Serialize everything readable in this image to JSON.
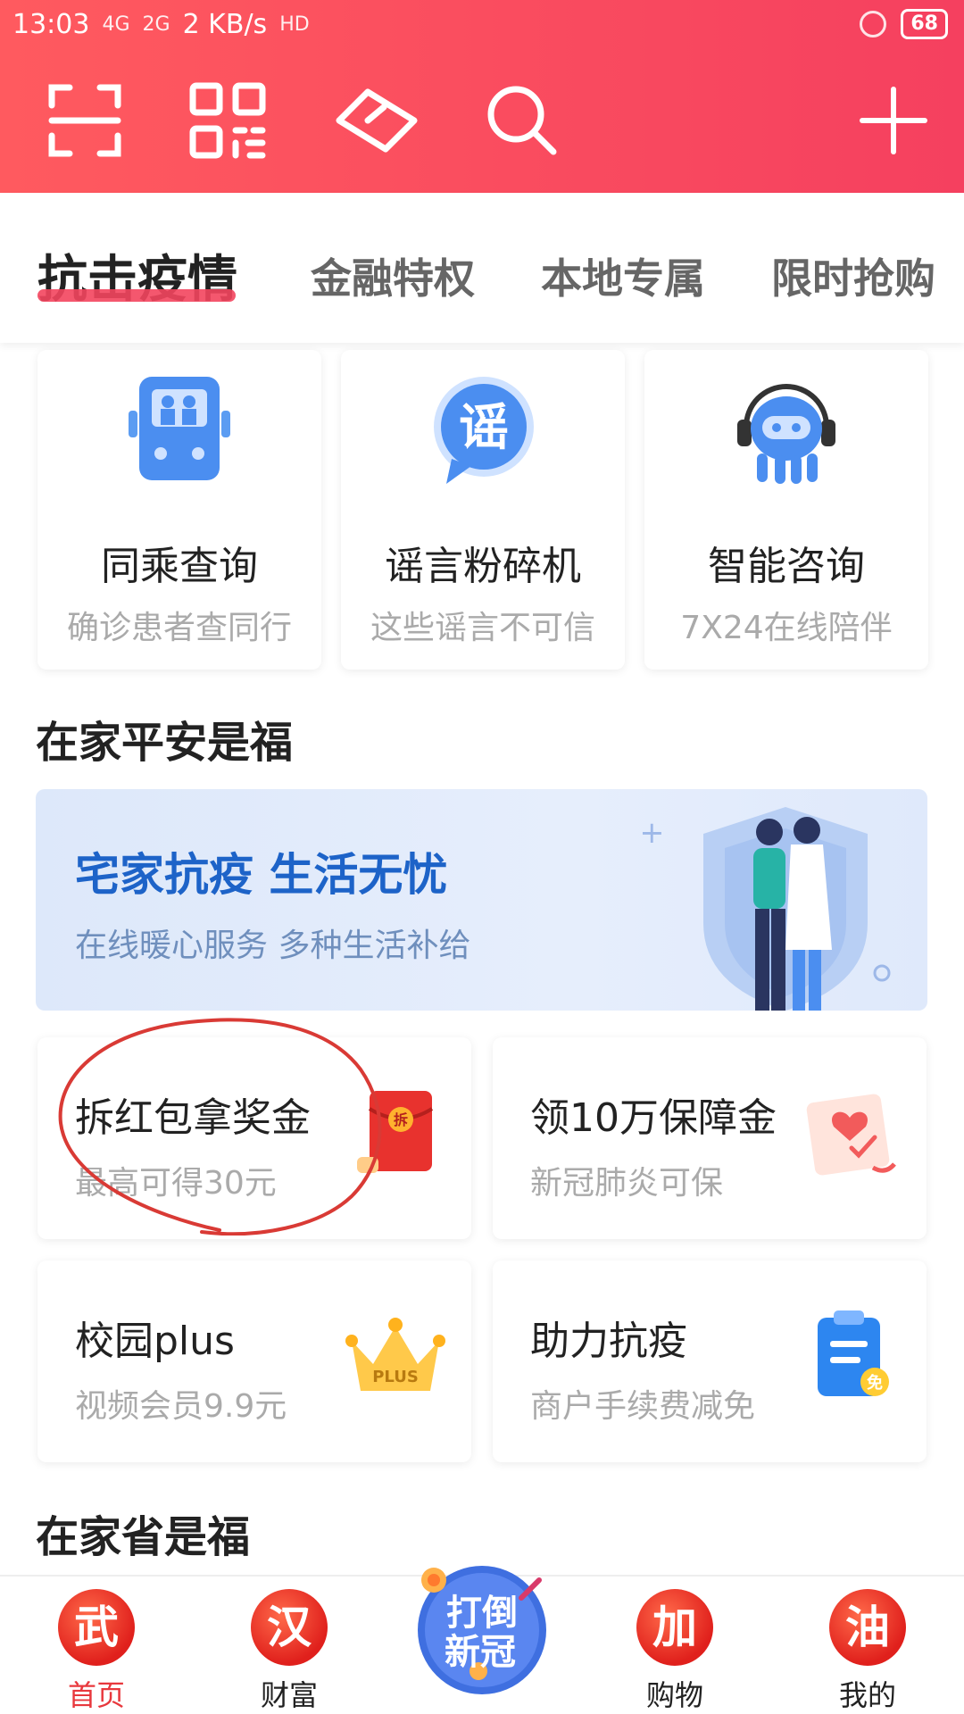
{
  "status_bar": {
    "time": "13:03",
    "signal_1": "4G",
    "signal_2": "2G",
    "speed": "2 KB/s",
    "hd": "HD",
    "battery": "68"
  },
  "toolbar": {
    "icons": [
      "scan-icon",
      "qr-code-icon",
      "card-icon",
      "search-icon",
      "plus-icon"
    ]
  },
  "tabs": [
    {
      "label": "抗击疫情",
      "active": true
    },
    {
      "label": "金融特权",
      "active": false
    },
    {
      "label": "本地专属",
      "active": false
    },
    {
      "label": "限时抢购",
      "active": false
    }
  ],
  "services": [
    {
      "title": "同乘查询",
      "subtitle": "确诊患者查同行",
      "icon": "bus-icon"
    },
    {
      "title": "谣言粉碎机",
      "subtitle": "这些谣言不可信",
      "icon": "rumor-icon",
      "icon_text": "谣"
    },
    {
      "title": "智能咨询",
      "subtitle": "7X24在线陪伴",
      "icon": "robot-icon"
    }
  ],
  "section1": {
    "title": "在家平安是福"
  },
  "banner": {
    "title": "宅家抗疫 生活无忧",
    "subtitle": "在线暖心服务 多种生活补给"
  },
  "promos": [
    {
      "title": "拆红包拿奖金",
      "subtitle": "最高可得30元",
      "icon": "red-envelope-icon",
      "icon_text": "拆"
    },
    {
      "title": "领10万保障金",
      "subtitle": "新冠肺炎可保",
      "icon": "certificate-icon"
    },
    {
      "title": "校园plus",
      "subtitle": "视频会员9.9元",
      "icon": "crown-icon",
      "icon_text": "PLUS"
    },
    {
      "title": "助力抗疫",
      "subtitle": "商户手续费减免",
      "icon": "clipboard-icon",
      "icon_text": "免"
    }
  ],
  "section2": {
    "title": "在家省是福"
  },
  "bottom_nav": [
    {
      "badge": "武",
      "label": "首页",
      "active": true
    },
    {
      "badge": "汉",
      "label": "财富",
      "active": false
    },
    {
      "badge": "加",
      "label": "购物",
      "active": false
    },
    {
      "badge": "油",
      "label": "我的",
      "active": false
    }
  ],
  "center_button": {
    "line1": "打倒",
    "line2": "新冠"
  },
  "colors": {
    "header": "#f5405f",
    "accent": "#e8383d",
    "banner_blue": "#1d63c8"
  }
}
